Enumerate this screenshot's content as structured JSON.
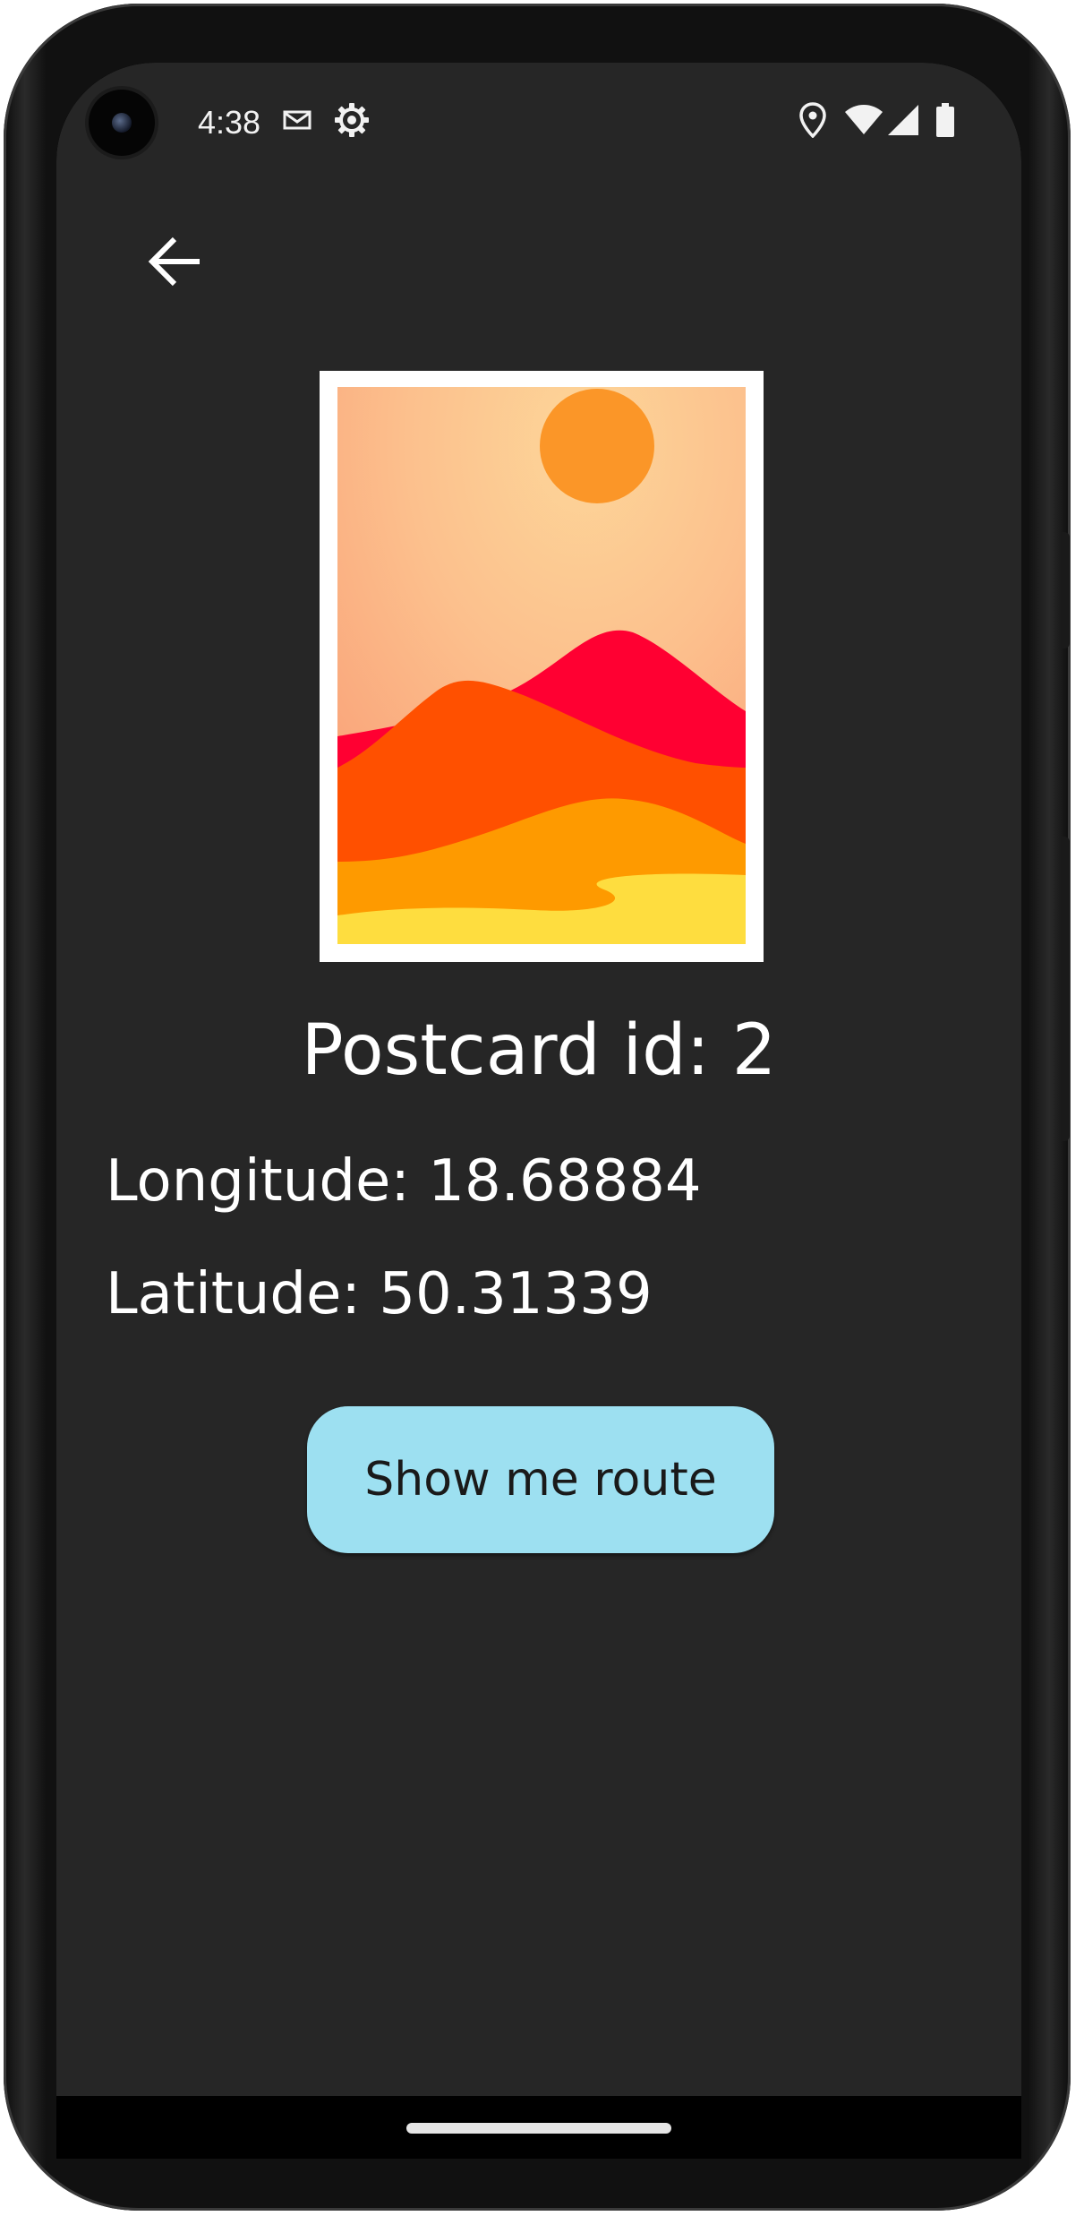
{
  "status_bar": {
    "time": "4:38",
    "icons": [
      "mail-icon",
      "settings-gear-icon",
      "location-icon",
      "wifi-icon",
      "cellular-signal-icon",
      "battery-icon"
    ]
  },
  "toolbar": {
    "back_icon": "arrow-back-icon"
  },
  "postcard": {
    "image": "landscape-sunset-illustration",
    "title": "Postcard id: 2",
    "longitude": "Longitude: 18.68884",
    "latitude": "Latitude: 50.31339"
  },
  "actions": {
    "route_button_label": "Show me route"
  },
  "colors": {
    "background": "#262626",
    "button": "#9de0f1",
    "text": "#ffffff"
  }
}
